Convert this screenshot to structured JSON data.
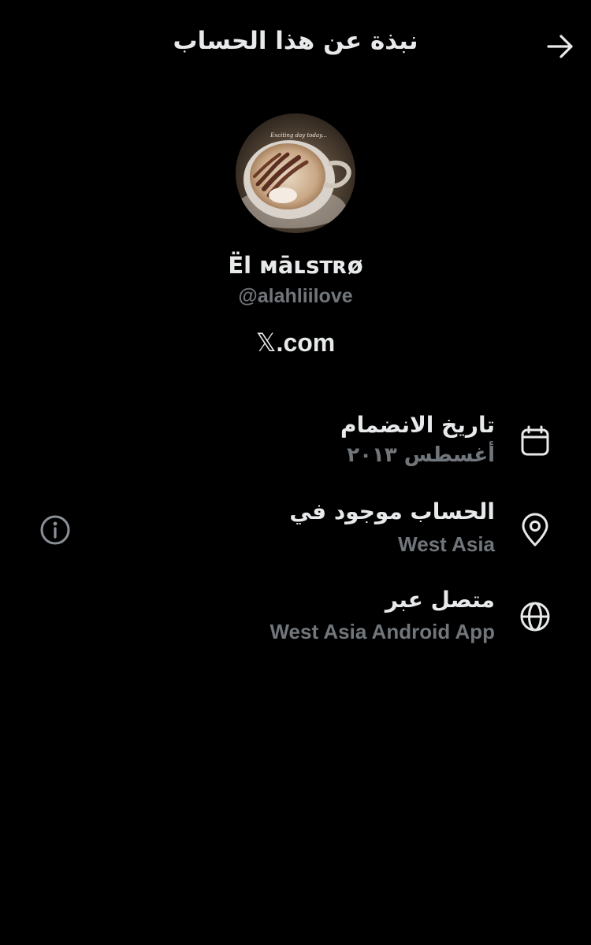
{
  "header": {
    "title": "نبذة عن هذا الحساب",
    "back_icon": "arrow-right-icon"
  },
  "profile": {
    "display_name": "Ël ᴍāʟsᴛʀø",
    "handle": "@alahliilove",
    "site_x": "𝕏",
    "site_rest": ".com",
    "avatar_caption": "Exciting day today..."
  },
  "details": [
    {
      "icon": "calendar-icon",
      "title": "تاريخ الانضمام",
      "value": "أغسطس ٢٠١٣"
    },
    {
      "icon": "location-pin-icon",
      "title": "الحساب موجود في",
      "value": "West Asia"
    },
    {
      "icon": "globe-icon",
      "title": "متصل عبر",
      "value": "West Asia Android App"
    }
  ],
  "colors": {
    "background": "#000000",
    "primary_text": "#e7e9ea",
    "secondary_text": "#71767b"
  }
}
